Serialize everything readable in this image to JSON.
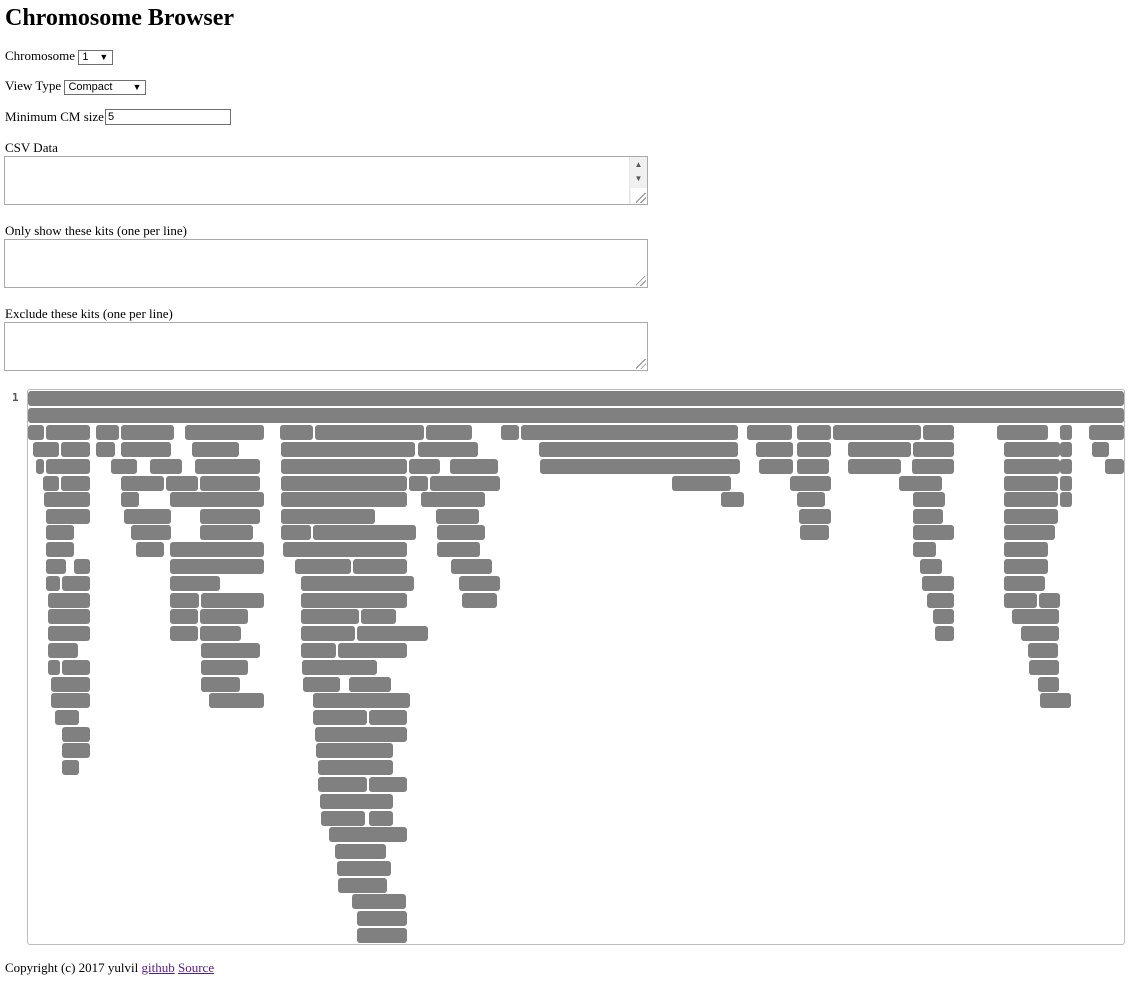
{
  "page": {
    "title": "Chromosome Browser"
  },
  "controls": {
    "chromosome": {
      "label": "Chromosome",
      "value": "1"
    },
    "view_type": {
      "label": "View Type",
      "value": "Compact"
    },
    "min_cm": {
      "label": "Minimum CM size",
      "value": "5"
    },
    "csv": {
      "label": "CSV Data",
      "value": ""
    },
    "only_kits": {
      "label": "Only show these kits (one per line)",
      "value": ""
    },
    "exclude_kits": {
      "label": "Exclude these kits (one per line)",
      "value": ""
    }
  },
  "browser": {
    "chromosome_label": "1",
    "segment_color": "#808080",
    "border_color": "#bdbdbd"
  },
  "footer": {
    "copyright": "Copyright (c) 2017 yulvil",
    "link_github": "github",
    "link_source": "Source",
    "link_color": "#551a8b"
  }
}
